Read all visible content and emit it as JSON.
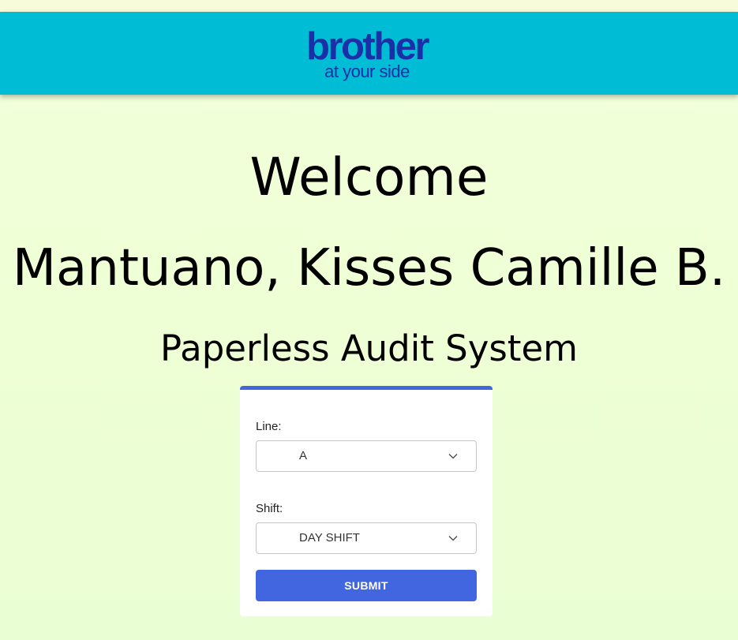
{
  "brand": {
    "name": "brother",
    "tagline": "at your side",
    "color": "#1b2fa8",
    "header_bg": "#00bcd4"
  },
  "welcome": {
    "greeting": "Welcome",
    "user_name": "Mantuano, Kisses Camille B.",
    "system_title": "Paperless Audit System"
  },
  "form": {
    "line_label": "Line:",
    "line_value": "A",
    "shift_label": "Shift:",
    "shift_value": "DAY SHIFT",
    "submit_label": "SUBMIT",
    "accent_color": "#4166e0"
  },
  "icons": {
    "dropdown": "chevron-down-icon"
  }
}
